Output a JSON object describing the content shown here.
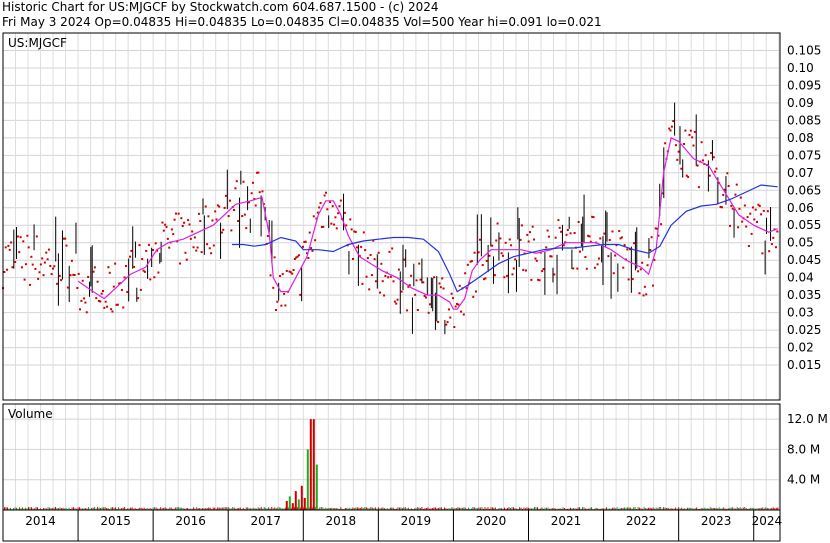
{
  "header": {
    "title": "Historic Chart for US:MJGCF by Stockwatch.com 604.687.1500 - (c) 2024",
    "quote": "Fri May  3 2024   Op=0.04835   Hi=0.04835   Lo=0.04835   Cl=0.04835   Vol=500   Year hi=0.091   lo=0.021"
  },
  "chart_data": [
    {
      "type": "line",
      "title": "US:MJGCF",
      "x_range": [
        2014.0,
        2024.35
      ],
      "ylim": [
        0.005,
        0.11
      ],
      "yticks": [
        "0.105",
        "0.10",
        "0.095",
        "0.09",
        "0.085",
        "0.08",
        "0.075",
        "0.07",
        "0.065",
        "0.06",
        "0.055",
        "0.05",
        "0.045",
        "0.04",
        "0.035",
        "0.03",
        "0.025",
        "0.02",
        "0.015"
      ],
      "ytick_values": [
        0.105,
        0.1,
        0.095,
        0.09,
        0.085,
        0.08,
        0.075,
        0.07,
        0.065,
        0.06,
        0.055,
        0.05,
        0.045,
        0.04,
        0.035,
        0.03,
        0.025,
        0.02,
        0.015
      ],
      "xtick_labels": [
        "2014",
        "2015",
        "2016",
        "2017",
        "2018",
        "2019",
        "2020",
        "2021",
        "2022",
        "2023",
        "2024"
      ],
      "xtick_values": [
        2014.0,
        2015.0,
        2016.0,
        2017.0,
        2018.0,
        2019.0,
        2020.0,
        2021.0,
        2022.0,
        2023.0,
        2024.0
      ],
      "grid": true,
      "series": [
        {
          "kind": "moving-average-fast",
          "color": "#dd22dd",
          "x": [
            2015.0,
            2015.2,
            2015.35,
            2015.5,
            2015.7,
            2015.9,
            2016.05,
            2016.2,
            2016.4,
            2016.6,
            2016.8,
            2016.95,
            2017.1,
            2017.3,
            2017.45,
            2017.55,
            2017.6,
            2017.7,
            2017.8,
            2017.9,
            2018.05,
            2018.2,
            2018.3,
            2018.4,
            2018.5,
            2018.6,
            2018.75,
            2018.9,
            2019.05,
            2019.25,
            2019.45,
            2019.65,
            2019.8,
            2019.95,
            2020.0,
            2020.05,
            2020.15,
            2020.25,
            2020.35,
            2020.5,
            2020.7,
            2020.9,
            2021.1,
            2021.3,
            2021.5,
            2021.7,
            2021.9,
            2022.1,
            2022.3,
            2022.5,
            2022.6,
            2022.7,
            2022.8,
            2022.9,
            2023.0,
            2023.2,
            2023.4,
            2023.6,
            2023.8,
            2024.0,
            2024.2,
            2024.32
          ],
          "y": [
            0.039,
            0.036,
            0.034,
            0.037,
            0.041,
            0.043,
            0.048,
            0.05,
            0.051,
            0.053,
            0.055,
            0.058,
            0.061,
            0.062,
            0.063,
            0.052,
            0.04,
            0.036,
            0.036,
            0.04,
            0.046,
            0.058,
            0.062,
            0.062,
            0.058,
            0.052,
            0.046,
            0.044,
            0.042,
            0.04,
            0.037,
            0.035,
            0.035,
            0.033,
            0.031,
            0.031,
            0.034,
            0.042,
            0.045,
            0.048,
            0.048,
            0.048,
            0.047,
            0.048,
            0.05,
            0.05,
            0.05,
            0.048,
            0.045,
            0.043,
            0.041,
            0.048,
            0.07,
            0.08,
            0.079,
            0.074,
            0.072,
            0.065,
            0.058,
            0.055,
            0.053,
            0.054
          ]
        },
        {
          "kind": "moving-average-slow",
          "color": "#2233dd",
          "x": [
            2017.05,
            2017.2,
            2017.35,
            2017.5,
            2017.7,
            2017.9,
            2018.0,
            2018.2,
            2018.4,
            2018.6,
            2018.8,
            2019.0,
            2019.2,
            2019.4,
            2019.6,
            2019.8,
            2019.95,
            2020.05,
            2020.2,
            2020.4,
            2020.6,
            2020.8,
            2021.0,
            2021.2,
            2021.4,
            2021.6,
            2021.8,
            2022.0,
            2022.2,
            2022.4,
            2022.6,
            2022.75,
            2022.9,
            2023.1,
            2023.3,
            2023.5,
            2023.7,
            2023.9,
            2024.1,
            2024.32
          ],
          "y": [
            0.0495,
            0.0495,
            0.049,
            0.0495,
            0.0515,
            0.0505,
            0.048,
            0.048,
            0.0475,
            0.0495,
            0.0505,
            0.051,
            0.0515,
            0.0515,
            0.051,
            0.0475,
            0.041,
            0.036,
            0.038,
            0.041,
            0.044,
            0.046,
            0.047,
            0.048,
            0.0485,
            0.0485,
            0.049,
            0.0495,
            0.0495,
            0.048,
            0.047,
            0.049,
            0.055,
            0.059,
            0.0605,
            0.061,
            0.0625,
            0.0645,
            0.0665,
            0.066
          ]
        }
      ]
    },
    {
      "type": "bar",
      "title": "Volume",
      "ylim": [
        0,
        14000000
      ],
      "yticks": [
        "12.0 M",
        "8.0 M",
        "4.0 M"
      ],
      "ytick_values": [
        12000000,
        8000000,
        4000000
      ],
      "x": [
        2017.78,
        2017.82,
        2017.86,
        2017.9,
        2017.94,
        2017.98,
        2018.02,
        2018.06,
        2018.1,
        2018.14,
        2018.18
      ],
      "values": [
        1200000,
        1800000,
        900000,
        2500000,
        1400000,
        3200000,
        1600000,
        8000000,
        12000000,
        12000000,
        6000000
      ]
    }
  ]
}
